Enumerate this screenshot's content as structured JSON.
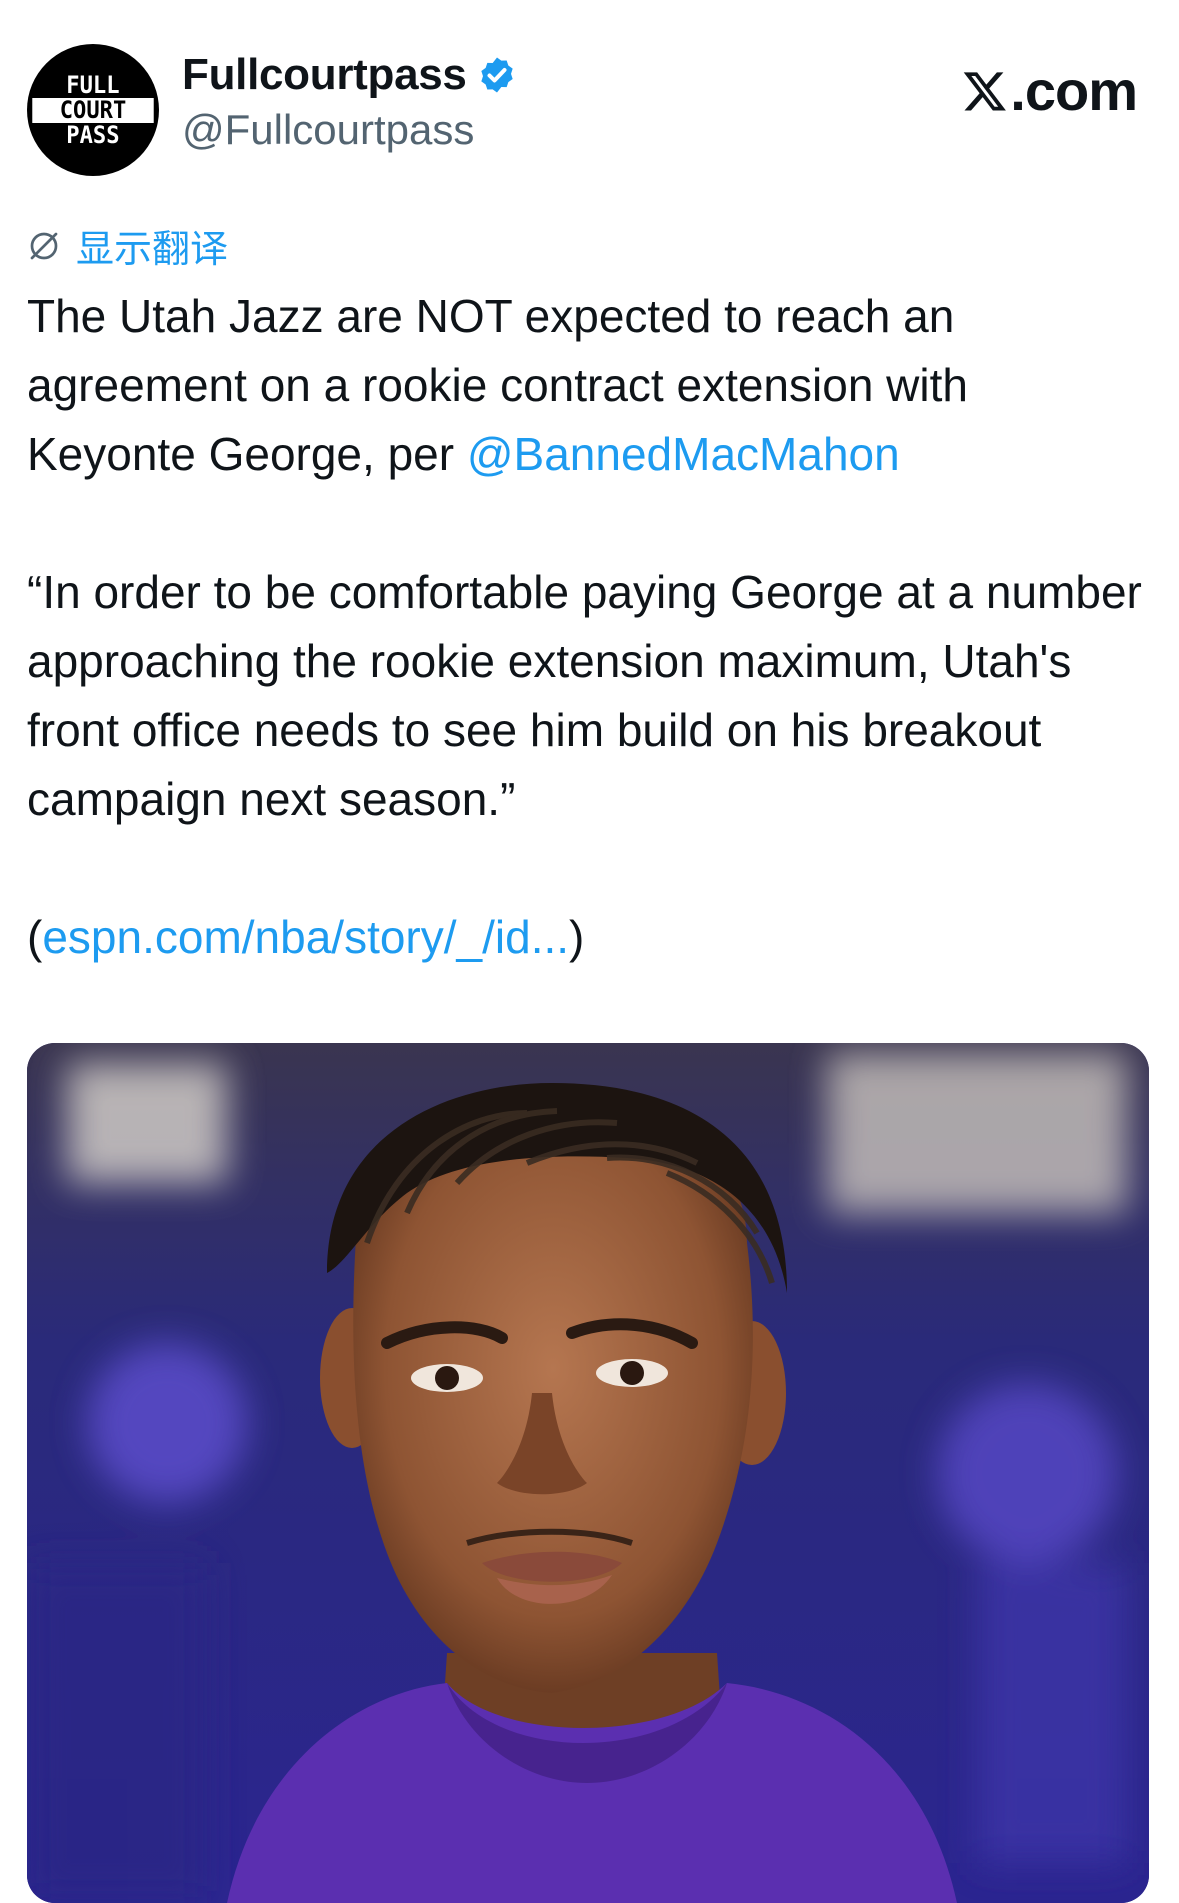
{
  "header": {
    "avatar_lines": [
      "FULL",
      "COURT",
      "PASS"
    ],
    "display_name": "Fullcourtpass",
    "handle": "@Fullcourtpass",
    "verified_icon": "verified-badge-icon",
    "brand": ".com"
  },
  "translate": {
    "icon": "translate-icon",
    "label": "显示翻译"
  },
  "tweet": {
    "p1_text": "The Utah Jazz are NOT expected to reach an agreement on a rookie contract extension with Keyonte George, per ",
    "p1_mention": "@BannedMacMahon",
    "quote": "“In order to be comfortable paying George at a number approaching the rookie extension maximum, Utah's front office needs to see him build on his breakout campaign next season.”",
    "link_open": "(",
    "link_text": "espn.com/nba/story/_/id...",
    "link_close": ")"
  },
  "colors": {
    "link": "#1d9bf0",
    "text": "#0f1419",
    "muted": "#536471",
    "jersey": "#5b2fb0"
  }
}
